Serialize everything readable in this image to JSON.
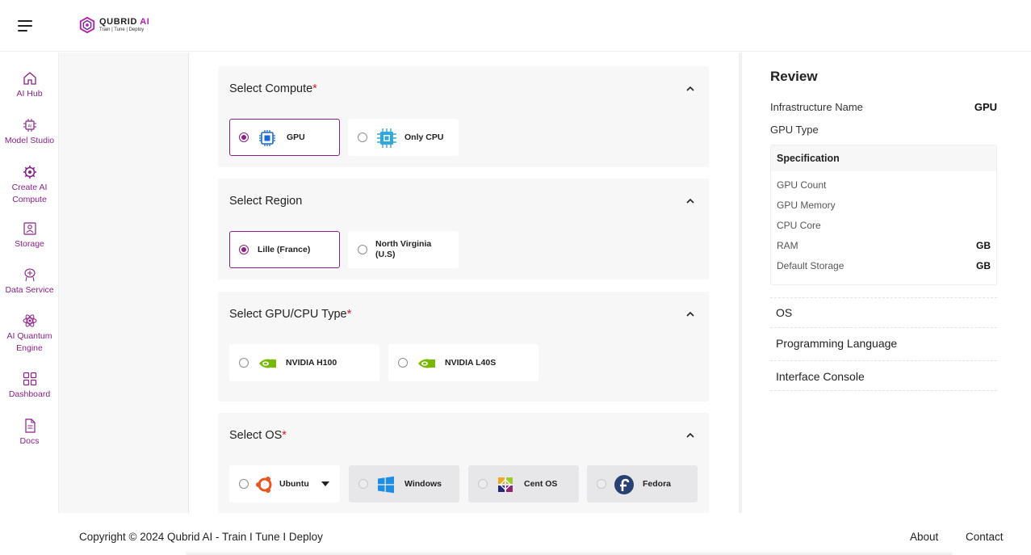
{
  "brand": {
    "name": "QUBRID",
    "name_ai": "AI",
    "tagline": "Train | Tune | Deploy",
    "accent": "#8a1f86"
  },
  "sidebar": {
    "items": [
      {
        "label": "AI Hub",
        "icon": "home-icon"
      },
      {
        "label": "Model Studio",
        "icon": "ai-chip-icon"
      },
      {
        "label": "Create AI Compute",
        "icon": "compute-gear-icon"
      },
      {
        "label": "Storage",
        "icon": "storage-icon"
      },
      {
        "label": "Data Service",
        "icon": "data-service-icon"
      },
      {
        "label": "AI Quantum Engine",
        "icon": "atom-icon"
      },
      {
        "label": "Dashboard",
        "icon": "dashboard-grid-icon"
      },
      {
        "label": "Docs",
        "icon": "document-icon"
      }
    ]
  },
  "sections": {
    "compute": {
      "title": "Select Compute",
      "required": "*",
      "options": [
        {
          "label": "GPU",
          "selected": true
        },
        {
          "label": "Only CPU",
          "selected": false
        }
      ]
    },
    "region": {
      "title": "Select Region",
      "options": [
        {
          "label": "Lille (France)",
          "selected": true
        },
        {
          "label": "North Virginia (U.S)",
          "selected": false
        }
      ]
    },
    "gpu_type": {
      "title": "Select GPU/CPU Type",
      "required": "*",
      "options": [
        {
          "label": "NVIDIA H100"
        },
        {
          "label": "NVIDIA L40S"
        }
      ]
    },
    "os": {
      "title": "Select OS",
      "required": "*",
      "options": [
        {
          "label": "Ubuntu"
        },
        {
          "label": "Windows"
        },
        {
          "label": "Cent OS"
        },
        {
          "label": "Fedora"
        }
      ]
    }
  },
  "review": {
    "title": "Review",
    "infrastructure_name_label": "Infrastructure Name",
    "infrastructure_name_value": "GPU",
    "gpu_type_label": "GPU Type",
    "spec": {
      "title": "Specification",
      "rows": [
        {
          "label": "GPU Count",
          "value": ""
        },
        {
          "label": "GPU Memory",
          "value": ""
        },
        {
          "label": "CPU Core",
          "value": ""
        },
        {
          "label": "RAM",
          "value": "GB"
        },
        {
          "label": "Default Storage",
          "value": "GB"
        }
      ]
    },
    "os_label": "OS",
    "programming_language_label": "Programming Language",
    "interface_console_label": "Interface Console"
  },
  "footer": {
    "copyright": "Copyright © 2024 Qubrid AI - Train I Tune I Deploy",
    "about": "About",
    "contact": "Contact"
  }
}
